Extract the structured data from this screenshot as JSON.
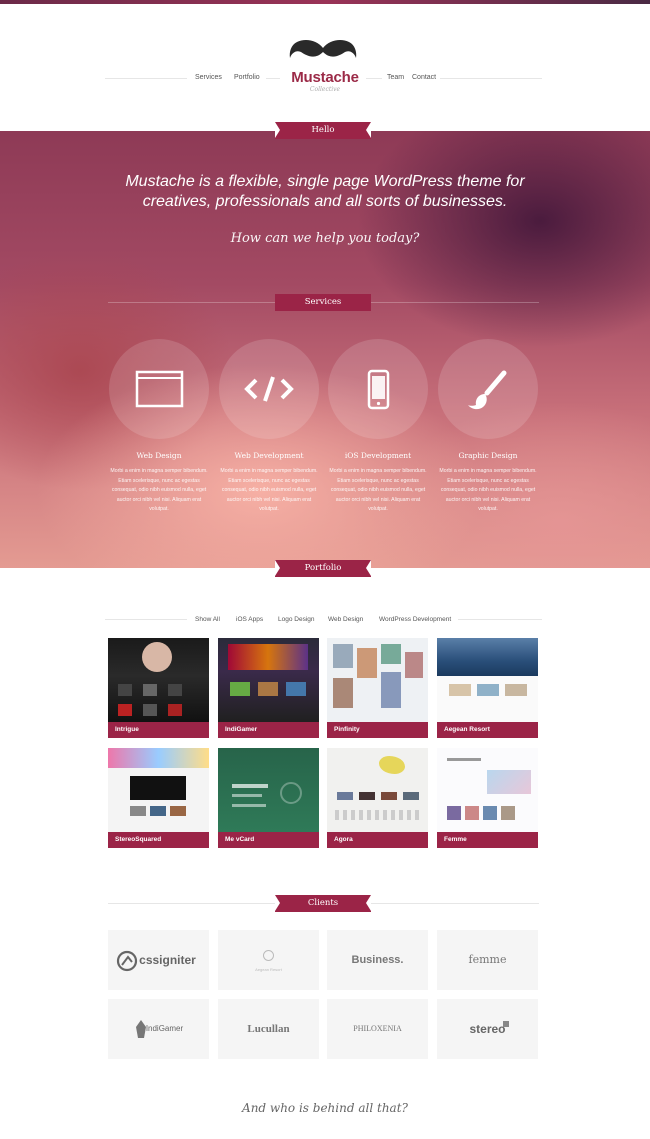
{
  "header": {
    "nav_left": [
      "Services",
      "Portfolio"
    ],
    "nav_right": [
      "Team",
      "Contact"
    ],
    "logo_title": "Mustache",
    "logo_subtitle": "Collective"
  },
  "hero": {
    "ribbon": "Hello",
    "title_line1": "Mustache is a flexible, single page WordPress theme for",
    "title_line2": "creatives, professionals and all sorts of businesses.",
    "subtitle": "How can we help you today?"
  },
  "services": {
    "ribbon": "Services",
    "items": [
      {
        "icon": "browser-window-icon",
        "title": "Web Design",
        "text": "Morbi a enim in magna semper bibendum. Etiam scelerisque, nunc ac egestas consequat, odio nibh euismod nulla, eget auctor orci nibh vel nisi. Aliquam erat volutpat."
      },
      {
        "icon": "code-icon",
        "title": "Web Development",
        "text": "Morbi a enim in magna semper bibendum. Etiam scelerisque, nunc ac egestas consequat, odio nibh euismod nulla, eget auctor orci nibh vel nisi. Aliquam erat volutpat."
      },
      {
        "icon": "phone-icon",
        "title": "iOS Development",
        "text": "Morbi a enim in magna semper bibendum. Etiam scelerisque, nunc ac egestas consequat, odio nibh euismod nulla, eget auctor orci nibh vel nisi. Aliquam erat volutpat."
      },
      {
        "icon": "brush-icon",
        "title": "Graphic Design",
        "text": "Morbi a enim in magna semper bibendum. Etiam scelerisque, nunc ac egestas consequat, odio nibh euismod nulla, eget auctor orci nibh vel nisi. Aliquam erat volutpat."
      }
    ]
  },
  "portfolio": {
    "ribbon": "Portfolio",
    "filters": [
      "Show All",
      "iOS Apps",
      "Logo Design",
      "Web Design",
      "WordPress Development"
    ],
    "items": [
      "Intrigue",
      "IndiGamer",
      "Pinfinity",
      "Aegean Resort",
      "StereoSquared",
      "Me vCard",
      "Agora",
      "Femme"
    ]
  },
  "clients": {
    "ribbon": "Clients",
    "items": [
      "cssigniter",
      "Aegean Resort",
      "Business.",
      "femme",
      "IndiGamer",
      "Lucullan",
      "PHILOXENIA",
      "stereo"
    ]
  },
  "footer": {
    "question": "And who is behind all that?"
  },
  "colors": {
    "accent": "#9b2447",
    "hero_top": "#8e3a56",
    "hero_bottom": "#e49b92"
  }
}
